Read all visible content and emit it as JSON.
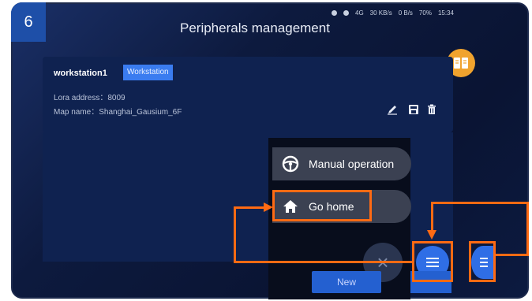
{
  "step_number": "6",
  "header": {
    "title": "Peripherals management",
    "status": {
      "signal": "4G",
      "speed_down": "30 KB/s",
      "wifi_speed": "0 B/s",
      "battery": "70%",
      "time": "15:34"
    }
  },
  "workstation": {
    "name": "workstation1",
    "type_badge": "Workstation",
    "lora_line": "Lora address：8009",
    "map_line": "Map name：Shanghai_Gausium_6F"
  },
  "menu": {
    "manual_label": "Manual operation",
    "home_label": "Go home"
  },
  "buttons": {
    "new_label": "New"
  },
  "colors": {
    "highlight": "#ff6a13",
    "accent": "#2f6ee6",
    "badge": "#1e4fa8",
    "book": "#f0a32e"
  }
}
